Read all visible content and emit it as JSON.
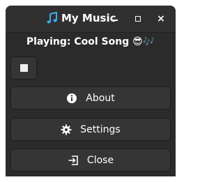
{
  "window": {
    "title": "My Music",
    "title_icon": "music-note-icon",
    "controls": {
      "minimize_icon": "minimize-icon",
      "maximize_icon": "maximize-icon",
      "close_label": "×"
    }
  },
  "player": {
    "status_text": "Playing: Cool Song 😎🎶",
    "stop_icon": "stop-icon"
  },
  "menu": {
    "about_label": "About",
    "about_icon": "info-icon",
    "settings_label": "Settings",
    "settings_icon": "gear-icon",
    "close_label": "Close",
    "close_icon": "exit-icon"
  },
  "colors": {
    "window_bg": "#2b2b2b",
    "titlebar_bg": "#303030",
    "button_bg": "#353535",
    "text": "#ffffff",
    "accent_blue": "#3daee9"
  }
}
